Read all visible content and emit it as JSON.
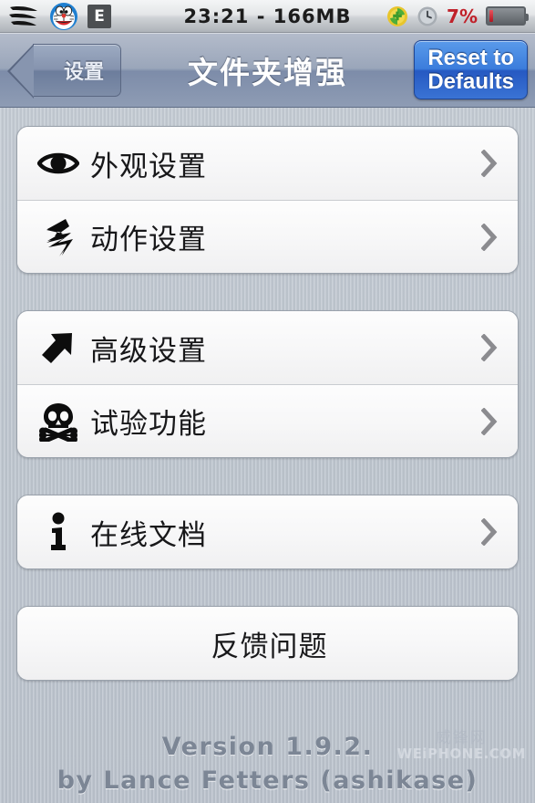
{
  "statusbar": {
    "carrier_icon": "wing-icon",
    "avatar_icon": "doraemon-avatar-icon",
    "network_badge": "E",
    "time_memory": "23:21 - 166MB",
    "plus_icon": "green-plus-icon",
    "clock_icon": "alarm-clock-icon",
    "battery_percent": "7%",
    "battery_icon": "battery-icon",
    "battery_level": 7
  },
  "navbar": {
    "back_label": "设置",
    "title": "文件夹增强",
    "reset_line1": "Reset to",
    "reset_line2": "Defaults"
  },
  "groups": [
    {
      "rows": [
        {
          "icon": "eye-icon",
          "label": "外观设置",
          "chevron": true
        },
        {
          "icon": "lightning-arrow-icon",
          "label": "动作设置",
          "chevron": true
        }
      ]
    },
    {
      "rows": [
        {
          "icon": "arrow-up-right-icon",
          "label": "高级设置",
          "chevron": true
        },
        {
          "icon": "skull-crossbones-icon",
          "label": "试验功能",
          "chevron": true
        }
      ]
    },
    {
      "rows": [
        {
          "icon": "info-i-icon",
          "label": "在线文档",
          "chevron": true
        }
      ]
    },
    {
      "rows": [
        {
          "icon": null,
          "label": "反馈问题",
          "chevron": false
        }
      ]
    }
  ],
  "footer": {
    "version": "Version 1.9.2.",
    "author": "by Lance Fetters (ashikase)"
  },
  "watermark": {
    "cn": "威锋网",
    "en": "WEiPHONE.COM",
    "blocks": "▥▥▥"
  },
  "colors": {
    "accent_blue": "#3b7ddc",
    "navbar_blue": "#8593ae",
    "background": "#c0c8d1",
    "battery_red": "#c0212a",
    "row_text": "#18181a"
  }
}
